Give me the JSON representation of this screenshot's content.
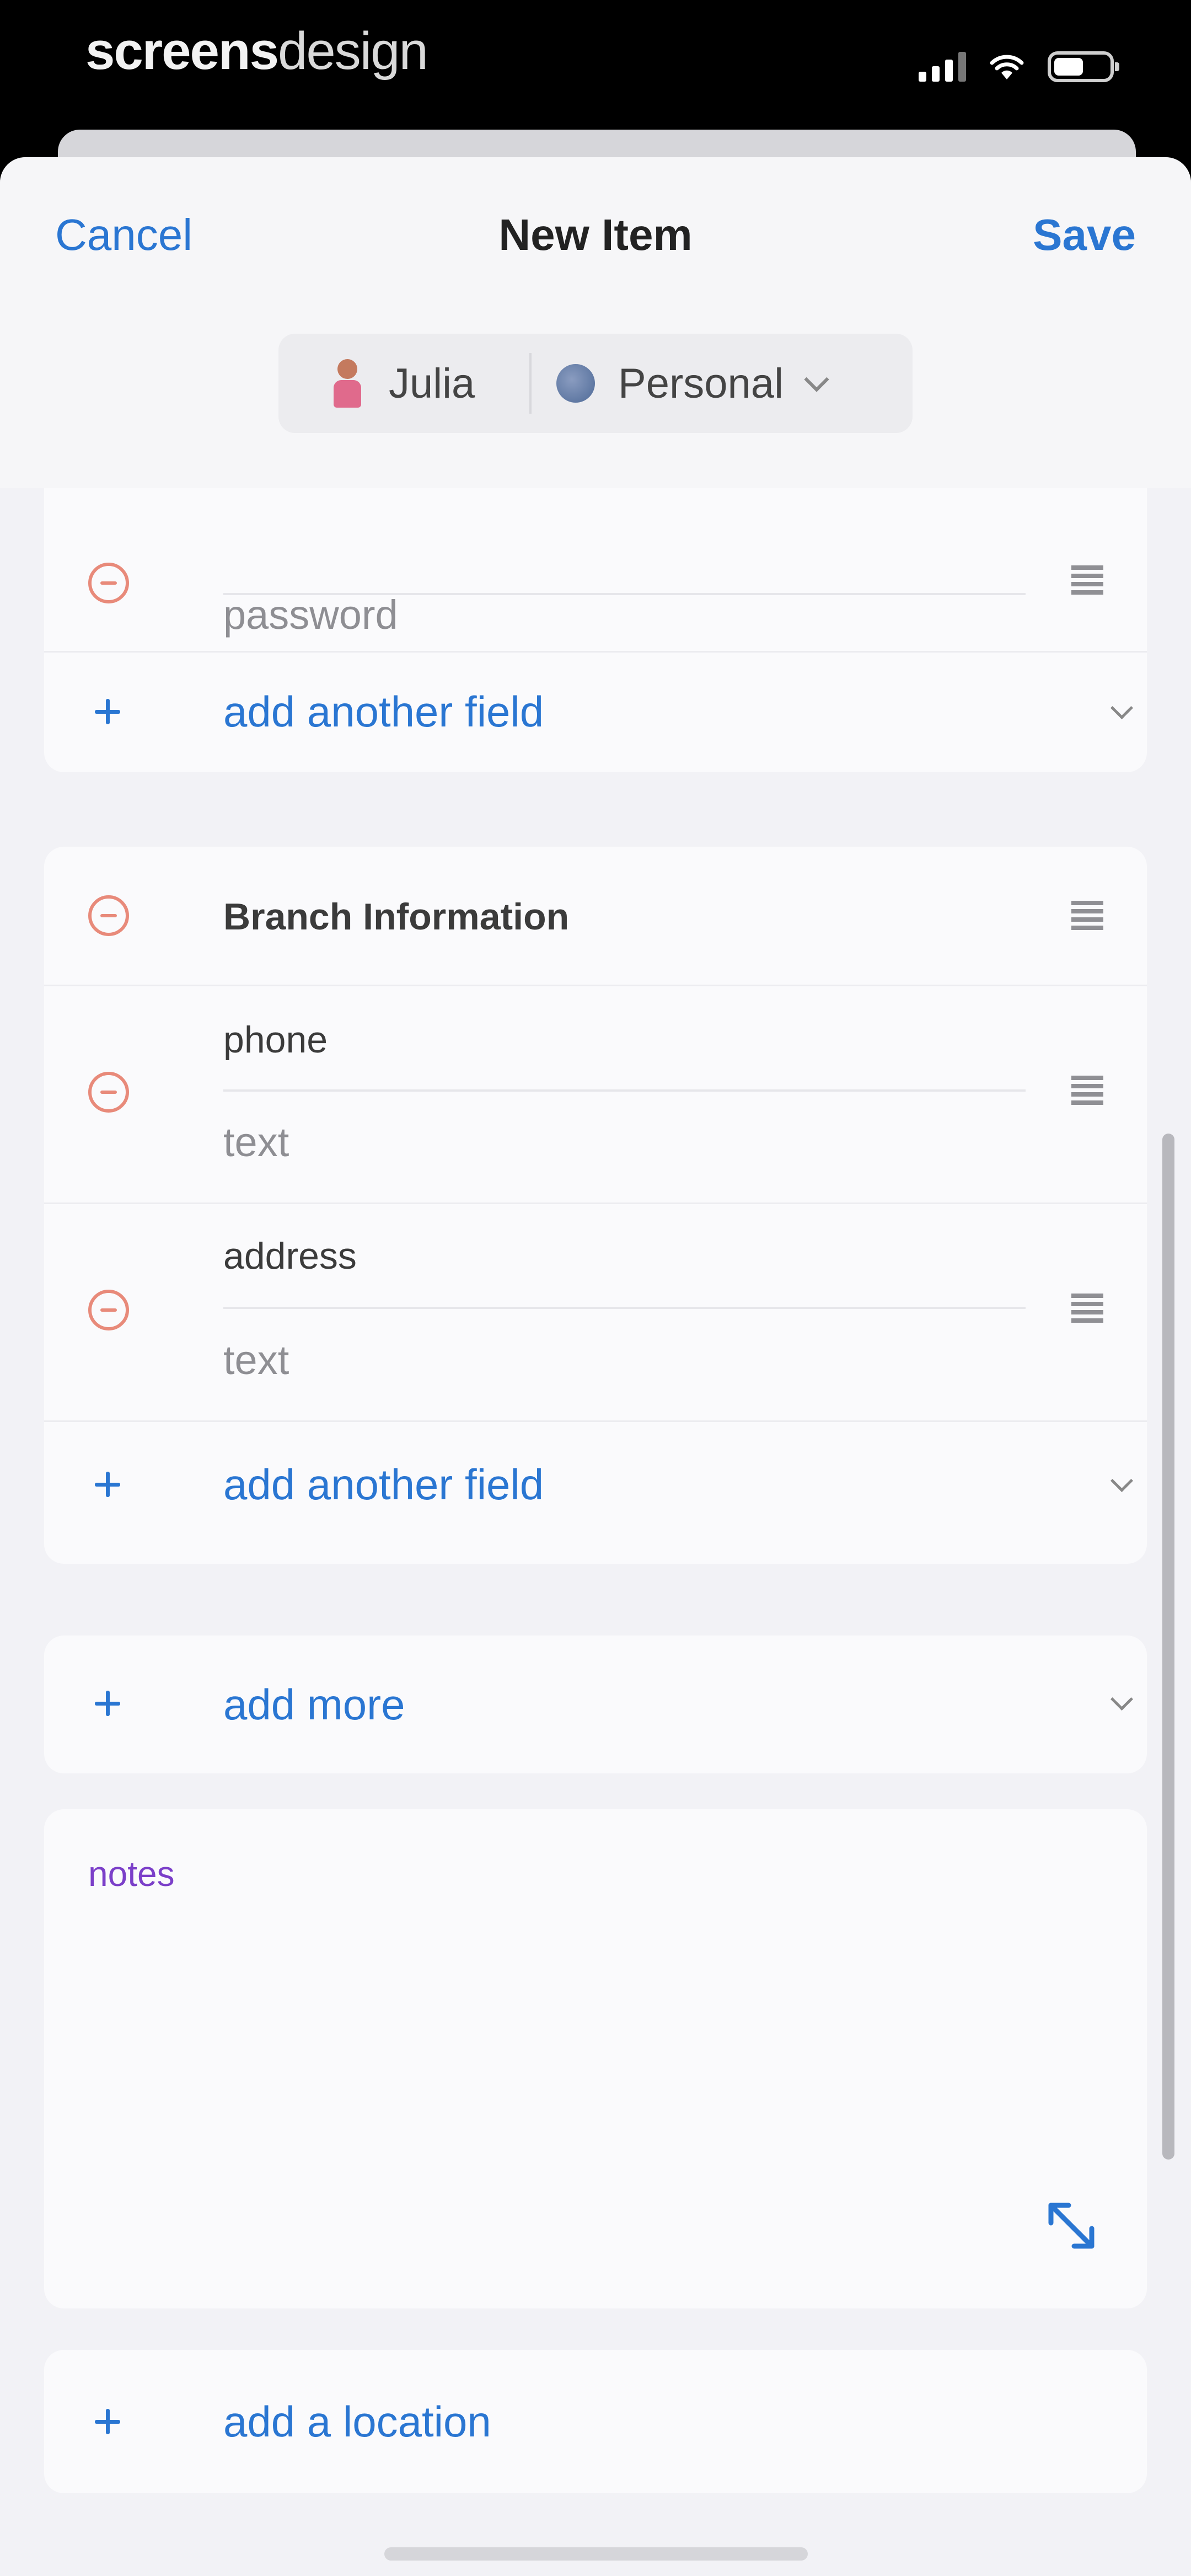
{
  "status_bar": {
    "brand_bold": "screens",
    "brand_light": "design"
  },
  "nav": {
    "cancel_label": "Cancel",
    "title": "New Item",
    "save_label": "Save"
  },
  "owner": {
    "user_name": "Julia",
    "vault_name": "Personal"
  },
  "section1": {
    "password_value": "password",
    "add_field_label": "add another field"
  },
  "section2": {
    "title": "Branch Information",
    "fields": [
      {
        "label": "phone",
        "value": "text"
      },
      {
        "label": "address",
        "value": "text"
      }
    ],
    "add_field_label": "add another field"
  },
  "add_more_label": "add more",
  "notes": {
    "label": "notes"
  },
  "location": {
    "add_label": "add a location"
  },
  "colors": {
    "accent": "#2a76d2",
    "destructive": "#e88a7a",
    "notes_label": "#7b3fc9"
  }
}
